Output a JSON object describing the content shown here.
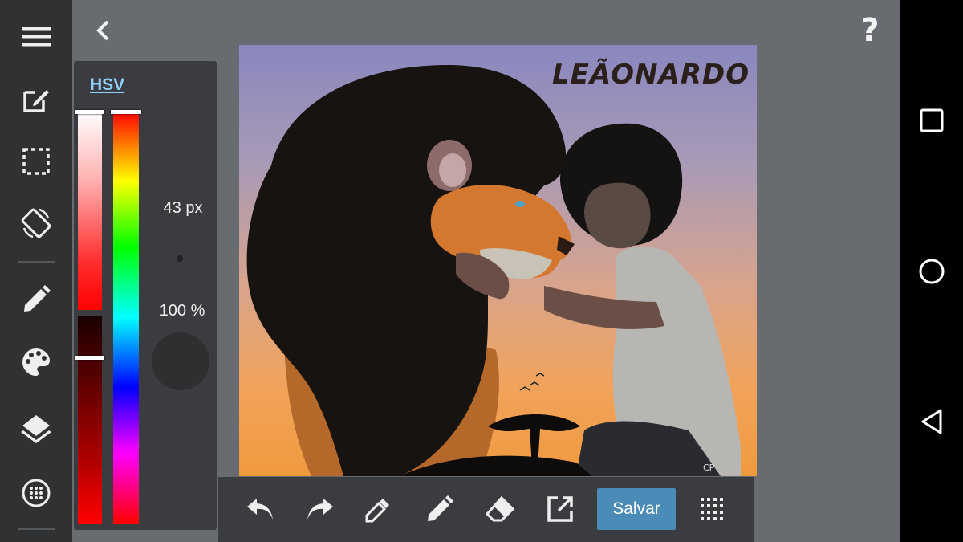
{
  "toolbar": {
    "icons": [
      "menu-icon",
      "edit-icon",
      "selection-icon",
      "rotate-icon",
      "brush-icon",
      "palette-icon",
      "layers-icon",
      "grid-icon"
    ]
  },
  "color_panel": {
    "mode_label": "HSV",
    "brush_size": "43 px",
    "opacity": "100 %"
  },
  "artwork": {
    "title_text": "LEÃONARDO",
    "signature": "CP"
  },
  "bottom_toolbar": {
    "save_label": "Salvar",
    "icons": [
      "undo-icon",
      "redo-icon",
      "eyedropper-icon",
      "pencil-icon",
      "eraser-icon",
      "open-external-icon",
      "apps-grid-icon"
    ]
  },
  "colors": {
    "accent": "#4a8bb8",
    "hsv_tab": "#8fd0f6",
    "panel": "#3a3c3f",
    "sidebar": "#2f3133",
    "workspace": "#686c70"
  }
}
